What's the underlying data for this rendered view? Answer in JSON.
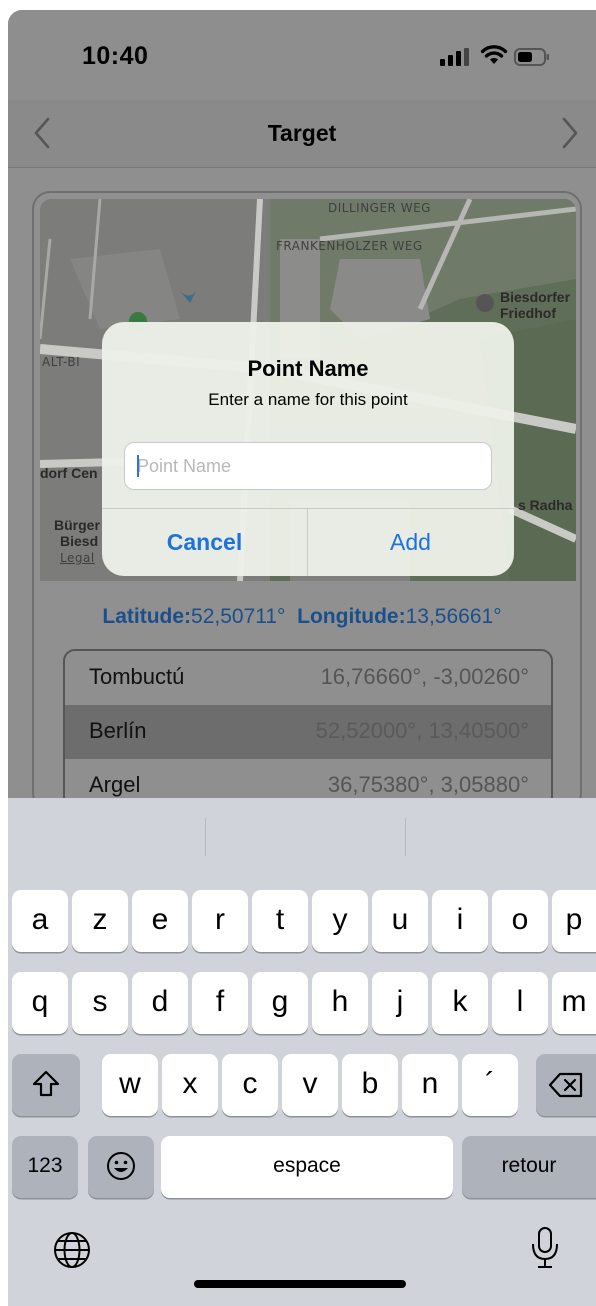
{
  "status": {
    "time": "10:40"
  },
  "nav": {
    "title": "Target"
  },
  "map": {
    "labels": {
      "dillinger": "DILLINGER WEG",
      "frankenholzer": "FRANKENHOLZER WEG",
      "friedhof_1": "Biesdorfer",
      "friedhof_2": "Friedhof",
      "alt": "ALT-BI",
      "cen": "dorf Cen",
      "radha": "s Radha",
      "burger_1": "Bürger",
      "burger_2": "Biesd",
      "legal": "Legal"
    }
  },
  "coords": {
    "lat_label": "Latitude:",
    "lat_value": "52,50711°",
    "lon_label": "Longitude:",
    "lon_value": "13,56661°"
  },
  "points": [
    {
      "name": "Tombuctú",
      "coords": "16,76660°, -3,00260°"
    },
    {
      "name": "Berlín",
      "coords": "52,52000°, 13,40500°"
    },
    {
      "name": "Argel",
      "coords": "36,75380°, 3,05880°"
    }
  ],
  "alert": {
    "title": "Point Name",
    "message": "Enter a name for this point",
    "input_value": "",
    "input_placeholder": "Point Name",
    "cancel_label": "Cancel",
    "add_label": "Add"
  },
  "keyboard": {
    "row1": [
      "a",
      "z",
      "e",
      "r",
      "t",
      "y",
      "u",
      "i",
      "o",
      "p"
    ],
    "row2": [
      "q",
      "s",
      "d",
      "f",
      "g",
      "h",
      "j",
      "k",
      "l",
      "m"
    ],
    "row3": [
      "w",
      "x",
      "c",
      "v",
      "b",
      "n",
      "´"
    ],
    "numbers_label": "123",
    "space_label": "espace",
    "return_label": "retour"
  },
  "colors": {
    "accent": "#1d72e0",
    "coords_text": "#1a4f8c"
  }
}
